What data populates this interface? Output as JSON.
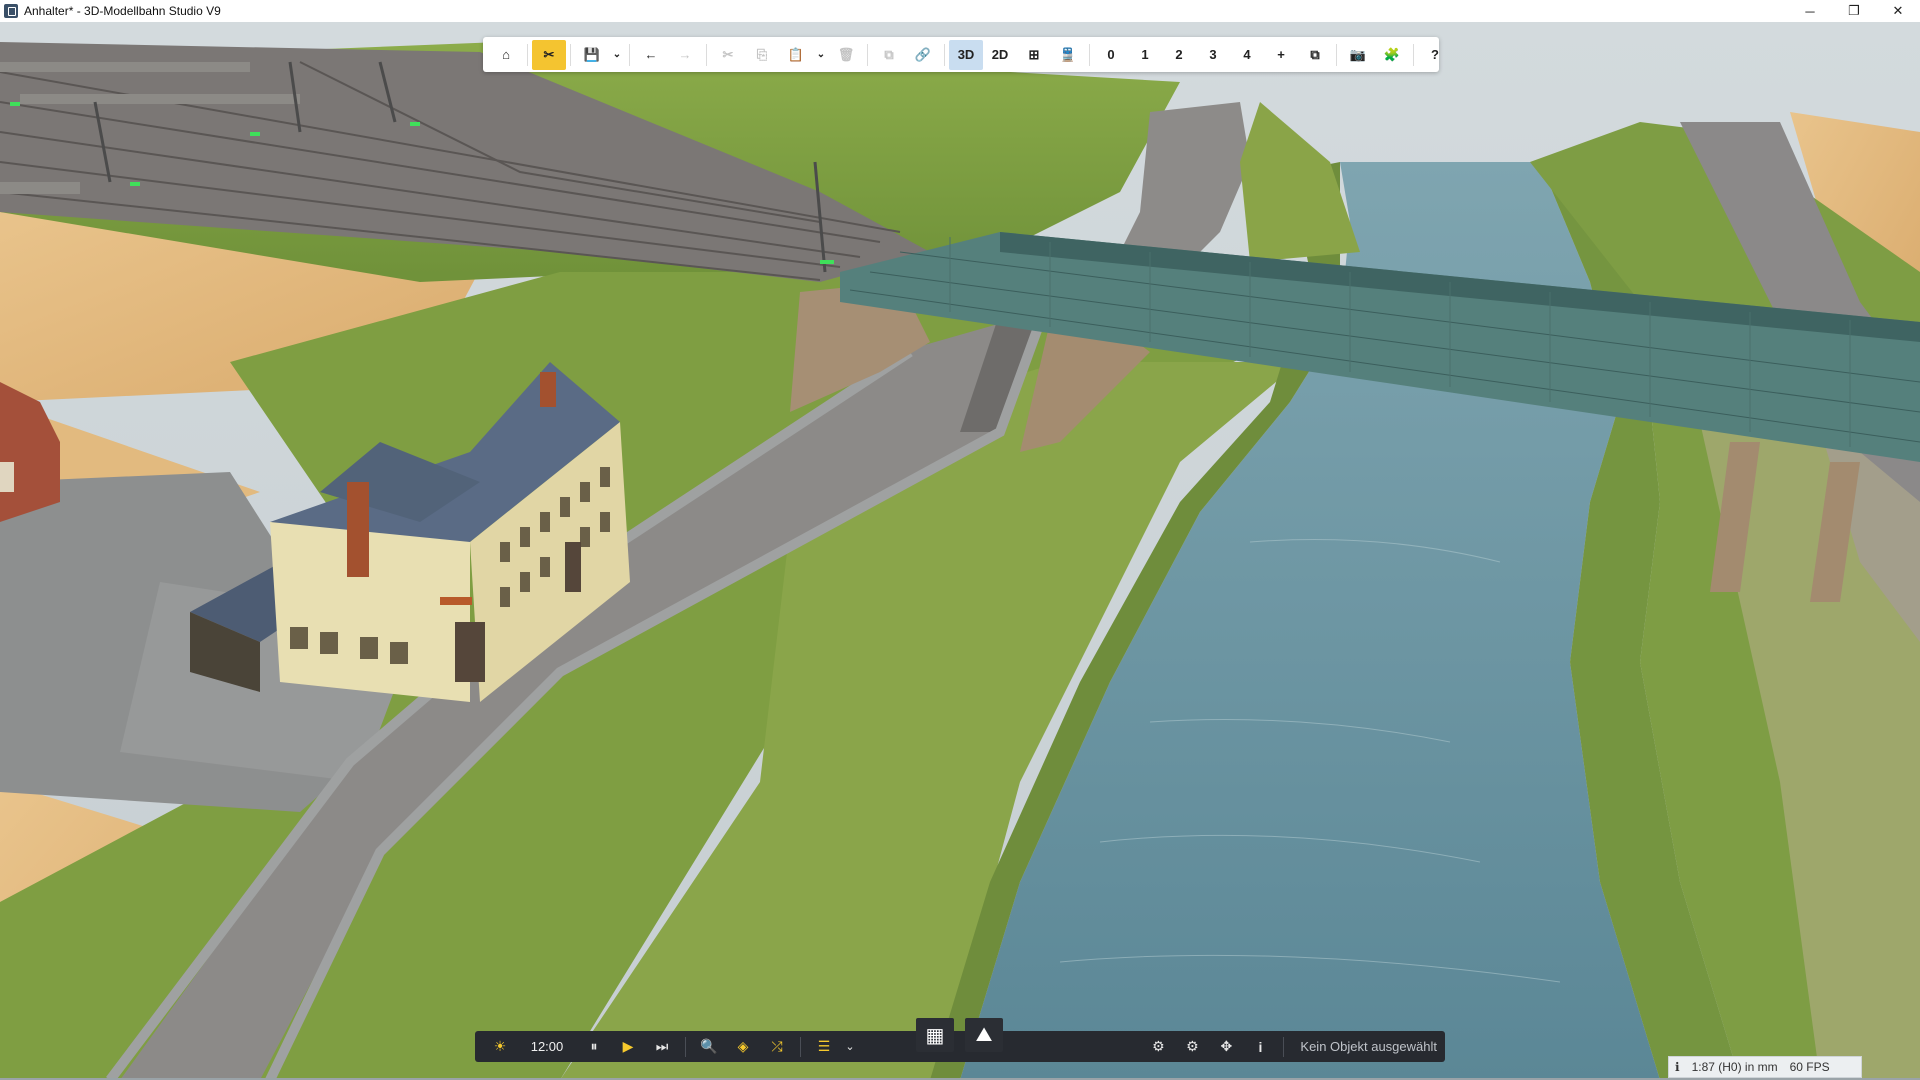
{
  "window": {
    "title": "Anhalter* - 3D-Modellbahn Studio V9",
    "controls": {
      "minimize": "─",
      "restore": "❐",
      "close": "✕"
    }
  },
  "toolbar": {
    "home": "⌂",
    "edit_tool": "✂",
    "save": "💾",
    "save_menu": "⌄",
    "undo": "←",
    "redo": "→",
    "cut": "✂",
    "copy": "⎘",
    "paste": "📋",
    "paste_menu": "⌄",
    "delete": "🗑",
    "duplicate": "⧉",
    "link": "🔗",
    "view_3d": "3D",
    "view_2d": "2D",
    "grid": "⊞",
    "train": "🚆",
    "layer_0": "0",
    "layer_1": "1",
    "layer_2": "2",
    "layer_3": "3",
    "layer_4": "4",
    "add": "+",
    "windows": "⧉",
    "camera": "📷",
    "plugins": "🧩",
    "help": "?"
  },
  "bottom": {
    "sun": "☀",
    "time": "12:00",
    "pause": "⏸",
    "play": "▶",
    "skip": "⏭",
    "search": "🔍",
    "layers": "◈",
    "random": "⤮",
    "list": "☰",
    "list_menu": "⌄",
    "tune": "⚙",
    "settings": "⚙",
    "tool": "✥",
    "info": "i",
    "status": "Kein Objekt ausgewählt"
  },
  "viewmodes": {
    "catalog": "▦",
    "terrain": "⛰"
  },
  "statusbar": {
    "info_icon": "ℹ",
    "scale": "1:87 (H0) in mm",
    "fps": "60 FPS"
  },
  "colors": {
    "toolbar_active_yellow": "#f4c430",
    "toolbar_active_blue": "#c9ddf0",
    "bottombar_bg": "#272a30",
    "accent_yellow": "#f6c92d"
  }
}
